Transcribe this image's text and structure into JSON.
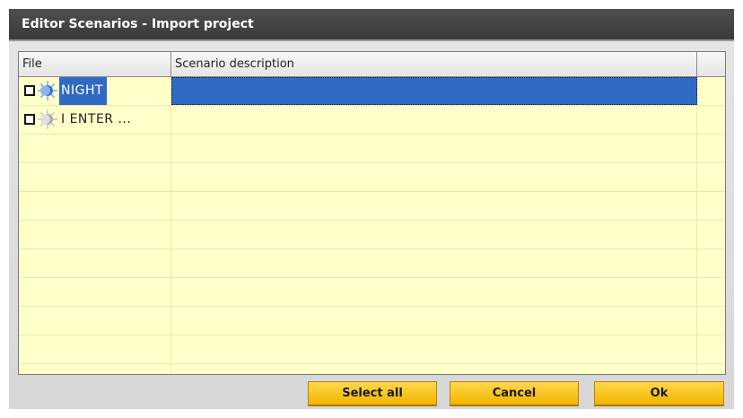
{
  "window": {
    "title": "Editor Scenarios - Import project"
  },
  "table": {
    "columns": [
      "File",
      "Scenario description",
      ""
    ],
    "rows": [
      {
        "file": "NIGHT",
        "description": "",
        "checked": false,
        "selected": true,
        "icon": "night-scenario-icon"
      },
      {
        "file": "I ENTER ...",
        "description": "",
        "checked": false,
        "selected": false,
        "icon": "enter-scenario-icon"
      }
    ]
  },
  "buttons": {
    "select_all": "Select all",
    "cancel": "Cancel",
    "ok": "Ok"
  },
  "colors": {
    "title_bar": "#3f3f3f",
    "grid_bg": "#ffffc8",
    "selection": "#316ac5",
    "button": "#f5c518"
  }
}
